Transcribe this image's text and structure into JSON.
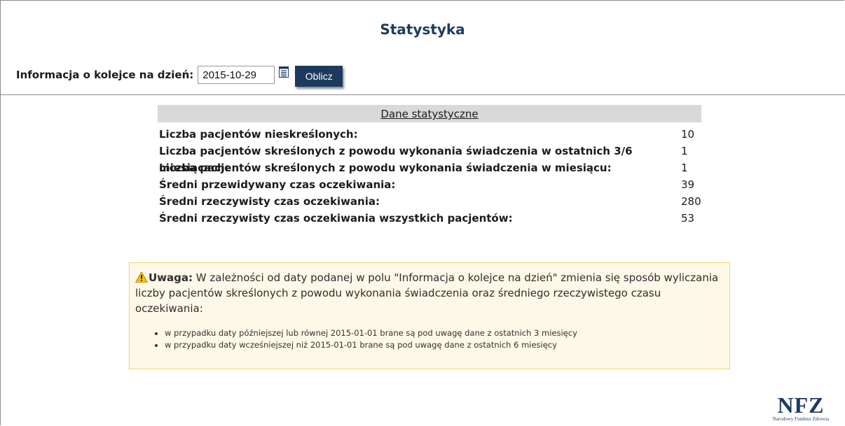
{
  "page": {
    "title": "Statystyka"
  },
  "date_form": {
    "label": "Informacja o kolejce na dzień:",
    "date_value": "2015-10-29",
    "calendar_icon": "calendar-icon",
    "submit_label": "Oblicz"
  },
  "stats": {
    "header": "Dane statystyczne",
    "rows": [
      {
        "label": "Liczba pacjentów nieskreślonych:",
        "value": "10"
      },
      {
        "label": "Liczba pacjentów skreślonych z powodu wykonania świadczenia w ostatnich 3/6 miesiącach:",
        "value": "1"
      },
      {
        "label": "Liczba pacjentów skreślonych z powodu wykonania świadczenia w miesiącu:",
        "value": "1"
      },
      {
        "label": "Średni przewidywany czas oczekiwania:",
        "value": "39"
      },
      {
        "label": "Średni rzeczywisty czas oczekiwania:",
        "value": "280"
      },
      {
        "label": "Średni rzeczywisty czas oczekiwania wszystkich pacjentów:",
        "value": "53"
      }
    ]
  },
  "warning": {
    "icon": "warning-icon",
    "title": "Uwaga:",
    "text": " W zależności od daty podanej w polu \"Informacja o kolejce na dzień\" zmienia się sposób wyliczania liczby pacjentów skreślonych z powodu wykonania świadczenia oraz średniego rzeczywistego czasu oczekiwania:",
    "items": [
      "w przypadku daty późniejszej lub równej 2015-01-01 brane są pod uwagę dane z ostatnich 3 miesięcy",
      "w przypadku daty wcześniejszej niż 2015-01-01 brane są pod uwagę dane z ostatnich 6 miesięcy"
    ]
  },
  "logo": {
    "mark": "NFZ",
    "subtitle": "Narodowy Fundusz Zdrowia"
  },
  "colors": {
    "brand": "#1d3a5e",
    "title": "#1f3c5c",
    "stats_header_bg": "#d9d9d9",
    "warning_bg": "#fdf8e7",
    "warning_border": "#f1d66b"
  }
}
